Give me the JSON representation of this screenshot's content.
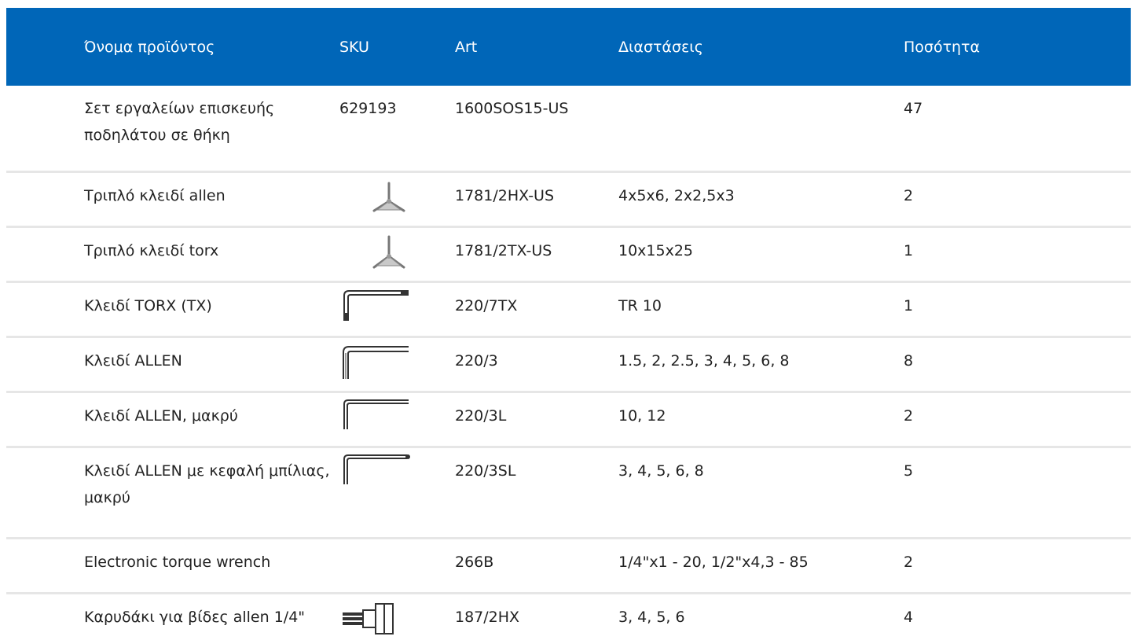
{
  "table": {
    "headers": {
      "name": "Όνομα προϊόντος",
      "sku": "SKU",
      "art": "Art",
      "dimensions": "Διαστάσεις",
      "quantity": "Ποσότητα"
    },
    "rows": [
      {
        "name": "Σετ εργαλείων επισκευής ποδηλάτου σε θήκη",
        "sku": "629193",
        "sku_icon": "",
        "art": "1600SOS15-US",
        "dimensions": "",
        "quantity": "47"
      },
      {
        "name": "Τριπλό κλειδί allen",
        "sku": "",
        "sku_icon": "y-hex-key-icon",
        "art": "1781/2HX-US",
        "dimensions": "4x5x6, 2x2,5x3",
        "quantity": "2"
      },
      {
        "name": "Τριπλό κλειδί torx",
        "sku": "",
        "sku_icon": "y-torx-key-icon",
        "art": "1781/2TX-US",
        "dimensions": "10x15x25",
        "quantity": "1"
      },
      {
        "name": "Κλειδί TORX (TX)",
        "sku": "",
        "sku_icon": "l-torx-key-icon",
        "art": "220/7TX",
        "dimensions": "TR 10",
        "quantity": "1"
      },
      {
        "name": "Κλειδί ALLEN",
        "sku": "",
        "sku_icon": "l-hex-key-icon",
        "art": "220/3",
        "dimensions": "1.5, 2, 2.5, 3, 4, 5, 6, 8",
        "quantity": "8"
      },
      {
        "name": "Κλειδί ALLEN, μακρύ",
        "sku": "",
        "sku_icon": "l-hex-key-long-icon",
        "art": "220/3L",
        "dimensions": "10, 12",
        "quantity": "2"
      },
      {
        "name": "Κλειδί ALLEN με κεφαλή μπίλιας, μακρύ",
        "sku": "",
        "sku_icon": "l-ball-hex-key-icon",
        "art": "220/3SL",
        "dimensions": "3, 4, 5, 6, 8",
        "quantity": "5"
      },
      {
        "name": "Electronic torque wrench",
        "sku": "",
        "sku_icon": "",
        "art": "266B",
        "dimensions": "1/4\"x1 - 20, 1/2\"x4,3 - 85",
        "quantity": "2"
      },
      {
        "name": "Καρυδάκι για βίδες allen 1/4\"",
        "sku": "",
        "sku_icon": "hex-bit-socket-icon",
        "art": "187/2HX",
        "dimensions": "3, 4, 5, 6",
        "quantity": "4"
      }
    ]
  },
  "colors": {
    "header_bg": "#0066b8",
    "header_text": "#ffffff",
    "row_divider": "#e6e6e6",
    "text": "#222222"
  }
}
